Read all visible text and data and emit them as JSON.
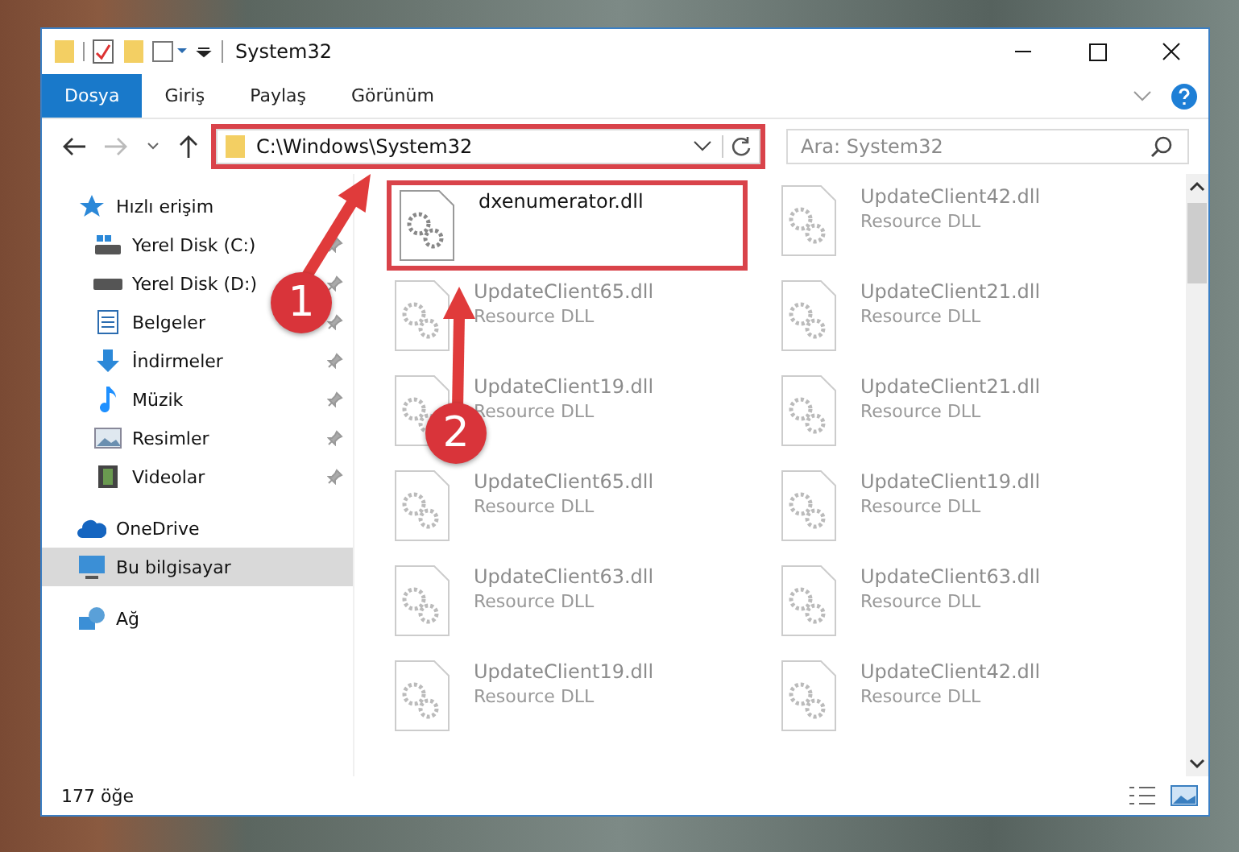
{
  "window": {
    "title": "System32"
  },
  "ribbon_tabs": [
    {
      "label": "Dosya",
      "selected": true
    },
    {
      "label": "Giriş",
      "selected": false
    },
    {
      "label": "Paylaş",
      "selected": false
    },
    {
      "label": "Görünüm",
      "selected": false
    }
  ],
  "address_bar": {
    "path": "C:\\Windows\\System32",
    "highlighted": true
  },
  "search": {
    "placeholder": "Ara: System32"
  },
  "nav": [
    {
      "label": "Hızlı erişim",
      "kind": "star",
      "selected": false,
      "children": [
        {
          "label": "Yerel Disk (C:)",
          "kind": "drive-system",
          "pinned": true
        },
        {
          "label": "Yerel Disk (D:)",
          "kind": "drive",
          "pinned": true
        },
        {
          "label": "Belgeler",
          "kind": "documents",
          "pinned": true
        },
        {
          "label": "İndirmeler",
          "kind": "downloads",
          "pinned": true
        },
        {
          "label": "Müzik",
          "kind": "music",
          "pinned": true
        },
        {
          "label": "Resimler",
          "kind": "pictures",
          "pinned": true
        },
        {
          "label": "Videolar",
          "kind": "videos",
          "pinned": true
        }
      ]
    },
    {
      "label": "OneDrive",
      "kind": "cloud",
      "selected": false
    },
    {
      "label": "Bu bilgisayar",
      "kind": "computer",
      "selected": true
    },
    {
      "label": "Ağ",
      "kind": "network",
      "selected": false
    }
  ],
  "files": [
    {
      "name": "dxenumerator.dll",
      "blurred": false,
      "highlighted": true
    },
    {
      "name": "UpdateClient42.dll",
      "type": "Resource DLL",
      "blurred": true,
      "highlighted": false
    },
    {
      "name": "UpdateClient65.dll",
      "type": "Resource DLL",
      "blurred": true,
      "highlighted": false
    },
    {
      "name": "UpdateClient21.dll",
      "type": "Resource DLL",
      "blurred": true,
      "highlighted": false
    },
    {
      "name": "UpdateClient19.dll",
      "type": "Resource DLL",
      "blurred": true,
      "highlighted": false
    },
    {
      "name": "UpdateClient21.dll",
      "type": "Resource DLL",
      "blurred": true,
      "highlighted": false
    },
    {
      "name": "UpdateClient65.dll",
      "type": "Resource DLL",
      "blurred": true,
      "highlighted": false
    },
    {
      "name": "UpdateClient19.dll",
      "type": "Resource DLL",
      "blurred": true,
      "highlighted": false
    },
    {
      "name": "UpdateClient63.dll",
      "type": "Resource DLL",
      "blurred": true,
      "highlighted": false
    },
    {
      "name": "UpdateClient63.dll",
      "type": "Resource DLL",
      "blurred": true,
      "highlighted": false
    },
    {
      "name": "UpdateClient19.dll",
      "type": "Resource DLL",
      "blurred": true,
      "highlighted": false
    },
    {
      "name": "UpdateClient42.dll",
      "type": "Resource DLL",
      "blurred": true,
      "highlighted": false
    }
  ],
  "status_bar": {
    "count": "177 öğe"
  },
  "annotations": [
    {
      "label": "1"
    },
    {
      "label": "2"
    }
  ]
}
